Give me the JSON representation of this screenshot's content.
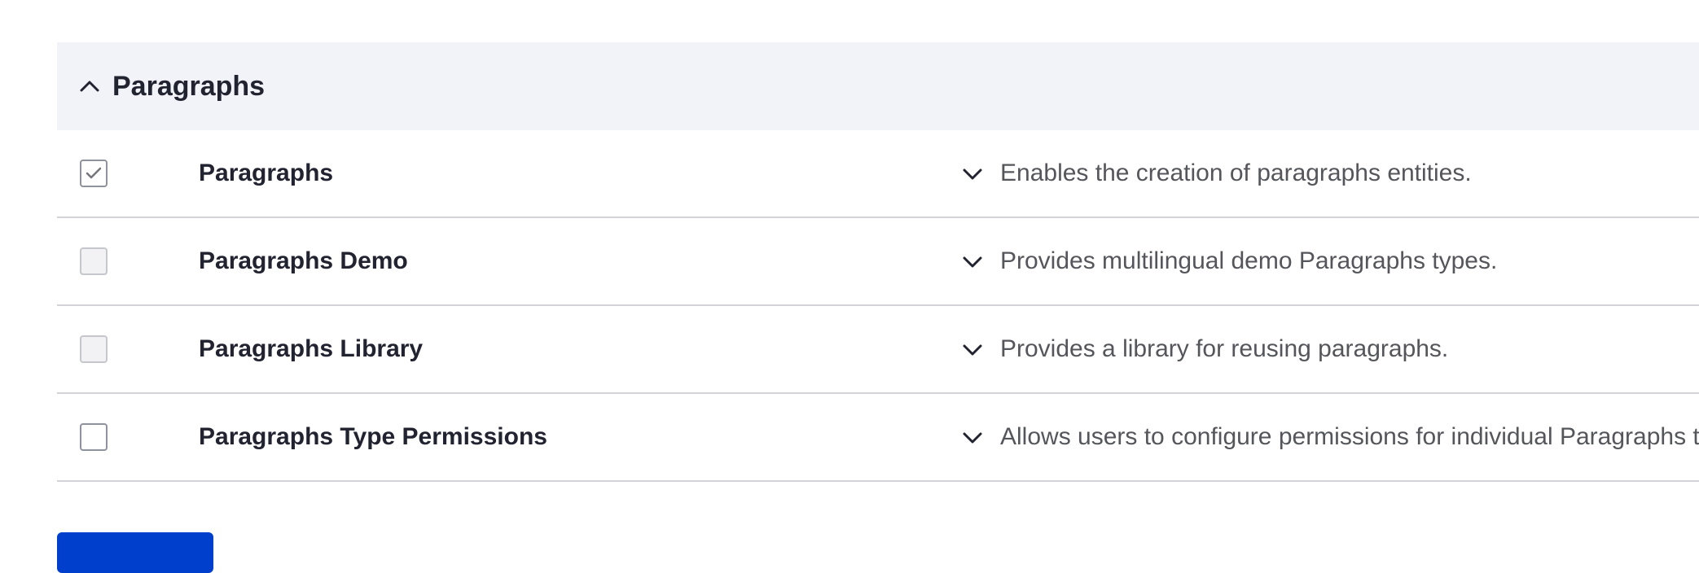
{
  "group": {
    "title": "Paragraphs",
    "expanded": true
  },
  "modules": [
    {
      "name": "Paragraphs",
      "description": "Enables the creation of paragraphs entities.",
      "checked": true,
      "disabled": true
    },
    {
      "name": "Paragraphs Demo",
      "description": "Provides multilingual demo Paragraphs types.",
      "checked": false,
      "disabled": true
    },
    {
      "name": "Paragraphs Library",
      "description": "Provides a library for reusing paragraphs.",
      "checked": false,
      "disabled": true
    },
    {
      "name": "Paragraphs Type Permissions",
      "description": "Allows users to configure permissions for individual Paragraphs types.",
      "checked": false,
      "disabled": false
    }
  ],
  "colors": {
    "header_bg": "#f2f3f8",
    "primary_button": "#003ecc",
    "text": "#222330",
    "muted_text": "#55565b"
  }
}
